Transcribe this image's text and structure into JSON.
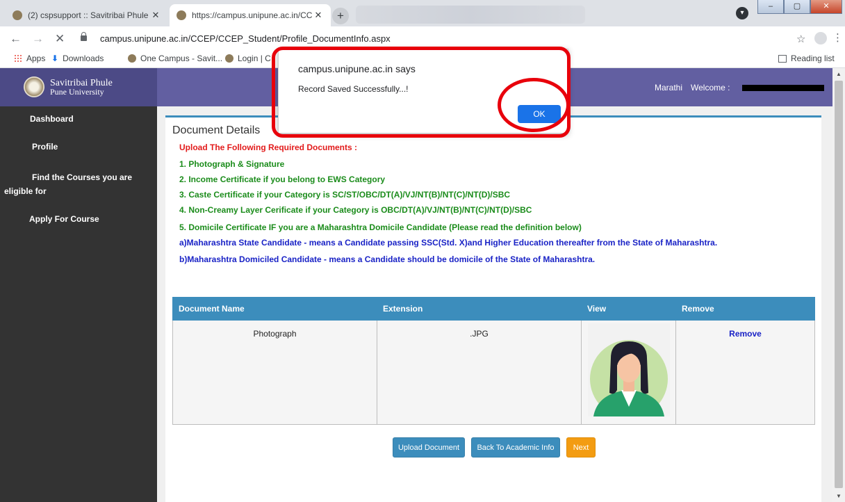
{
  "browser": {
    "tabs": [
      {
        "title": "(2) cspsupport :: Savitribai Phule",
        "close": "✕"
      },
      {
        "title": "https://campus.unipune.ac.in/CCI",
        "close": "✕"
      }
    ],
    "new_tab": "+",
    "url": "campus.unipune.ac.in/CCEP/CCEP_Student/Profile_DocumentInfo.aspx",
    "bookmarks": [
      "Apps",
      "Downloads",
      "One Campus - Savit...",
      "Login | C"
    ],
    "reading_list": "Reading list"
  },
  "header": {
    "logo_line1": "Savitribai Phule",
    "logo_line2": "Pune University",
    "language": "Marathi",
    "welcome": "Welcome :"
  },
  "sidebar": {
    "items": [
      {
        "label": "Dashboard"
      },
      {
        "label": "Profile"
      },
      {
        "label": "Find the Courses you are"
      },
      {
        "label": "eligible for"
      },
      {
        "label": "Apply For Course"
      }
    ]
  },
  "content": {
    "title": "Document Details",
    "heading": "Upload The Following Required Documents :",
    "requirements": [
      "1. Photograph & Signature",
      "2. Income Certificate if you belong to EWS Category",
      "3. Caste Certificate if your Category is SC/ST/OBC/DT(A)/VJ/NT(B)/NT(C)/NT(D)/SBC",
      "4. Non-Creamy Layer Cerificate if your Category is OBC/DT(A)/VJ/NT(B)/NT(C)/NT(D)/SBC",
      "5. Domicile Certificate IF you are a Maharashtra Domicile Candidate (Please read the definition below)"
    ],
    "definitions": [
      "a)Maharashtra State Candidate - means a Candidate passing SSC(Std. X)and Higher Education thereafter from the State of Maharashtra.",
      "b)Maharashtra Domiciled Candidate - means a Candidate should be domicile of the State of Maharashtra."
    ]
  },
  "table": {
    "headers": [
      "Document Name",
      "Extension",
      "View",
      "Remove"
    ],
    "rows": [
      {
        "name": "Photograph",
        "extension": ".JPG",
        "remove": "Remove"
      }
    ]
  },
  "buttons": {
    "upload": "Upload Document",
    "back": "Back To Academic Info",
    "next": "Next"
  },
  "dialog": {
    "title": "campus.unipune.ac.in says",
    "message": "Record Saved Successfully...!",
    "ok": "OK"
  },
  "colors": {
    "header": "#625fa1",
    "sidebar": "#333333",
    "accent": "#3c8dbc",
    "next_button": "#f39c12",
    "highlight": "#e8000b"
  }
}
